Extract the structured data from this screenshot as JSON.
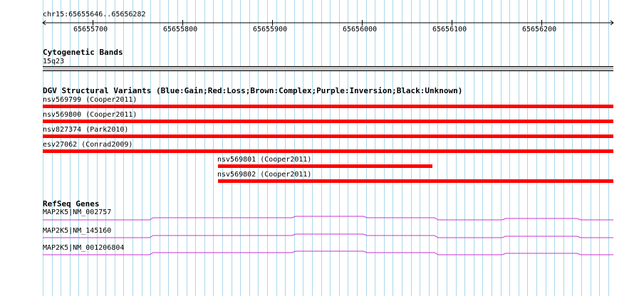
{
  "ruler": {
    "region": "chr15:65655646..65656282",
    "ticks": [
      "65655700",
      "65655800",
      "65655900",
      "65656000",
      "65656100",
      "65656200"
    ]
  },
  "tracks": {
    "cytoband": {
      "title": "Cytogenetic Bands",
      "band_label": "15q23",
      "band_color": "#c8c8c8"
    },
    "dgv": {
      "title": "DGV Structural Variants (Blue:Gain;Red:Loss;Brown:Complex;Purple:Inversion;Black:Unknown)",
      "color": "#ff0000",
      "features": [
        {
          "label": "nsv569799 (Cooper2011)",
          "start": 65655646,
          "end": 65656282
        },
        {
          "label": "nsv569800 (Cooper2011)",
          "start": 65655646,
          "end": 65656282
        },
        {
          "label": "nsv827374 (Park2010)",
          "start": 65655646,
          "end": 65656282
        },
        {
          "label": "esv27062 (Conrad2009)",
          "start": 65655646,
          "end": 65656282
        },
        {
          "label": "nsv569801 (Cooper2011)",
          "start": 65655841,
          "end": 65656080
        },
        {
          "label": "nsv569802 (Cooper2011)",
          "start": 65655841,
          "end": 65656282
        }
      ]
    },
    "refseq": {
      "title": "RefSeq Genes",
      "color": "#cc33cc",
      "genes": [
        {
          "label": "MAP2K5|NM_002757"
        },
        {
          "label": "MAP2K5|NM_145160"
        },
        {
          "label": "MAP2K5|NM_001206804"
        }
      ]
    }
  }
}
